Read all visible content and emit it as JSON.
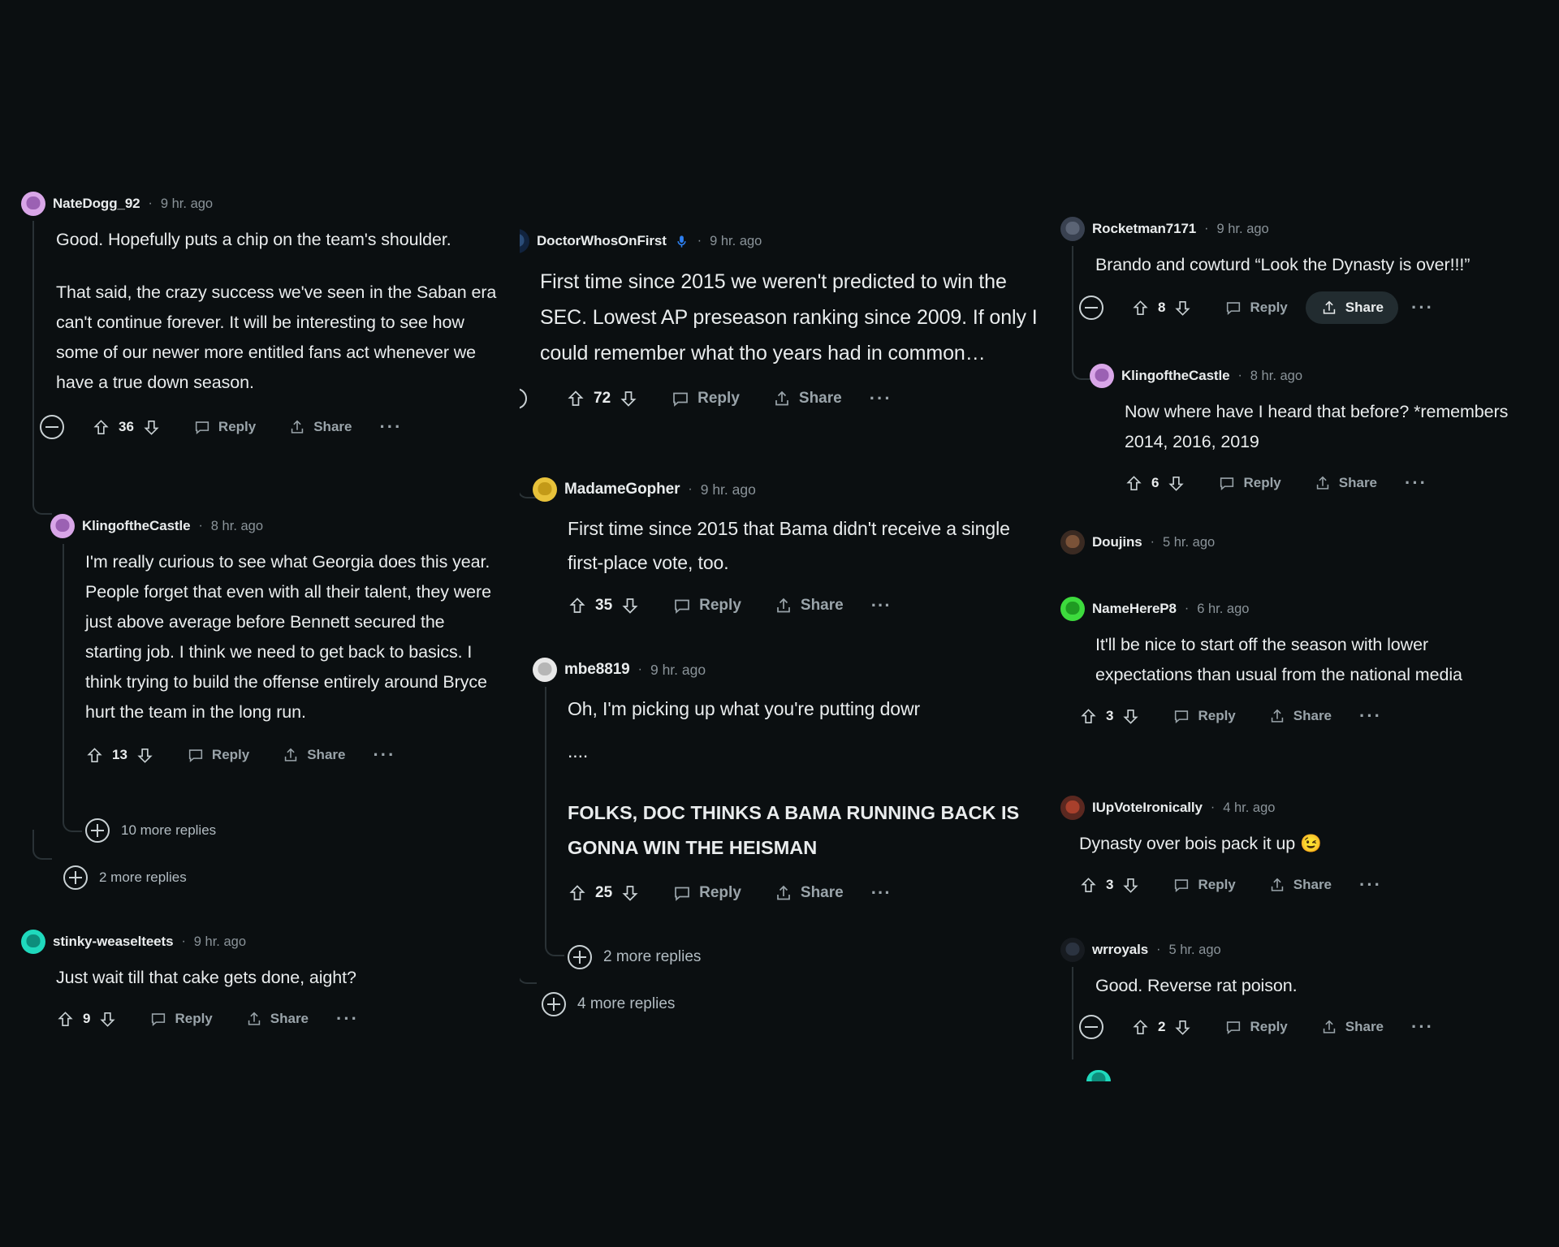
{
  "theme": {
    "background": "#000000",
    "pane_background": "#0b0f11",
    "text": "#e9eced",
    "muted": "#8a9399",
    "action": "#9aa4aa",
    "threadline": "#2a3236",
    "divider": "#1b2226",
    "share_hover_bg": "#222c30"
  },
  "labels": {
    "reply": "Reply",
    "share": "Share",
    "dot": "·",
    "ellipsis": "···"
  },
  "icons": {
    "upvote": "upvote-arrow-icon",
    "downvote": "downvote-arrow-icon",
    "reply": "comment-bubble-icon",
    "share": "share-arrow-icon",
    "overflow": "overflow-menu-icon",
    "collapse": "collapse-minus-icon",
    "expand": "expand-plus-icon",
    "mic": "microphone-badge-icon"
  },
  "columns": {
    "left": {
      "comments": [
        {
          "id": "natedogg",
          "username": "NateDogg_92",
          "timestamp": "9 hr. ago",
          "avatar": "lav",
          "paragraphs": [
            "Good. Hopefully puts a chip on the team's shoulder.",
            "That said, the crazy success we've seen in the Saban era can't continue forever. It will be interesting to see how some of our newer more entitled fans act whenever we have a true down season."
          ],
          "score": "36"
        },
        {
          "id": "klingofthecastle-left",
          "username": "KlingoftheCastle",
          "timestamp": "8 hr. ago",
          "avatar": "lav",
          "paragraphs": [
            "I'm really curious to see what Georgia does this year. People forget that even with all their talent, they were just above average before Bennett secured the starting job. I think we need to get back to basics. I think trying to build the offense entirely around Bryce hurt the team in the long run."
          ],
          "score": "13",
          "more_replies": "10 more replies"
        },
        {
          "id": "natedogg-more",
          "more_replies": "2 more replies"
        },
        {
          "id": "stinky",
          "username": "stinky-weaselteets",
          "timestamp": "9 hr. ago",
          "avatar": "teal",
          "paragraphs": [
            "Just wait till that cake gets done, aight?"
          ],
          "score": "9"
        }
      ]
    },
    "middle": {
      "comments": [
        {
          "id": "doctorwhos",
          "username": "DoctorWhosOnFirst",
          "timestamp": "9 hr. ago",
          "avatar": "navy",
          "has_mic_badge": true,
          "paragraphs": [
            "First time since 2015 we weren't predicted to win the SEC. Lowest AP preseason ranking since 2009. If only I could remember what tho years had in common…"
          ],
          "score": "72"
        },
        {
          "id": "madamegopher",
          "username": "MadameGopher",
          "timestamp": "9 hr. ago",
          "avatar": "yellow",
          "paragraphs": [
            "First time since 2015 that Bama didn't receive a single first-place vote, too."
          ],
          "score": "35"
        },
        {
          "id": "mbe8819",
          "username": "mbe8819",
          "timestamp": "9 hr. ago",
          "avatar": "white",
          "paragraphs": [
            "Oh, I'm picking up what you're putting dowr",
            "...."
          ],
          "shout": "FOLKS, DOC THINKS A BAMA RUNNING BACK IS GONNA WIN THE HEISMAN",
          "score": "25",
          "more_replies": "2 more replies"
        },
        {
          "id": "doctorwhos-more",
          "more_replies": "4 more replies"
        }
      ]
    },
    "right": {
      "comments": [
        {
          "id": "rocketman",
          "username": "Rocketman7171",
          "timestamp": "9 hr. ago",
          "avatar": "grey",
          "paragraphs": [
            "Brando and cowturd “Look the Dynasty is over!!!”"
          ],
          "score": "8",
          "share_hovered": true
        },
        {
          "id": "klingofthecastle-right",
          "username": "KlingoftheCastle",
          "timestamp": "8 hr. ago",
          "avatar": "lav",
          "paragraphs": [
            "Now where have I heard that before? *remembers 2014, 2016, 2019"
          ],
          "score": "6"
        },
        {
          "id": "doujins",
          "username": "Doujins",
          "timestamp": "5 hr. ago",
          "avatar": "brown"
        },
        {
          "id": "namehere",
          "username": "NameHereP8",
          "timestamp": "6 hr. ago",
          "avatar": "green",
          "paragraphs": [
            "It'll be nice to start off the season with lower expectations than usual from the national media"
          ],
          "score": "3"
        },
        {
          "id": "iupvote",
          "username": "IUpVoteIronically",
          "timestamp": "4 hr. ago",
          "avatar": "red",
          "paragraphs": [
            "Dynasty over bois pack it up 😉"
          ],
          "score": "3"
        },
        {
          "id": "wrroyals",
          "username": "wrroyals",
          "timestamp": "5 hr. ago",
          "avatar": "dark",
          "paragraphs": [
            "Good. Reverse rat poison."
          ],
          "score": "2"
        }
      ]
    }
  }
}
